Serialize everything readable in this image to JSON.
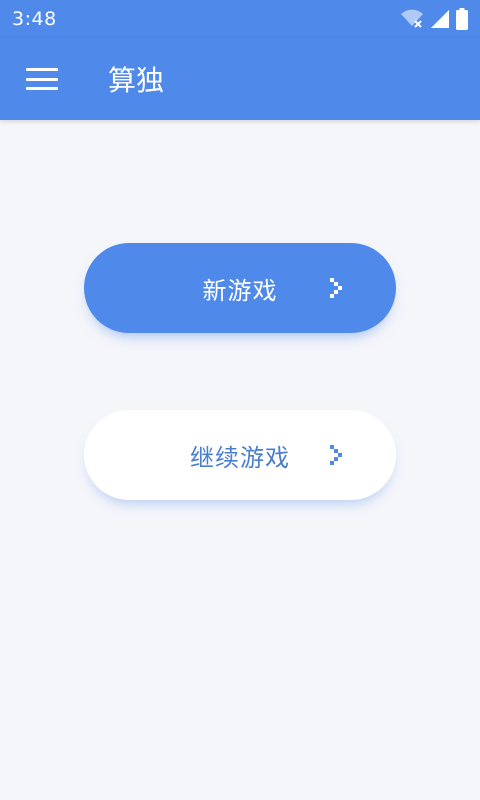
{
  "status_bar": {
    "time": "3:48",
    "icons": [
      "wifi-off-icon",
      "signal-icon",
      "battery-icon"
    ]
  },
  "app_bar": {
    "menu_icon": "menu-icon",
    "title": "算独"
  },
  "buttons": {
    "new_game": "新游戏",
    "continue_game": "继续游戏",
    "arrow_icon": "chevron-right-icon"
  },
  "colors": {
    "primary": "#4f89ea",
    "background": "#f5f6fa",
    "continue_text": "#4a7ecf"
  }
}
